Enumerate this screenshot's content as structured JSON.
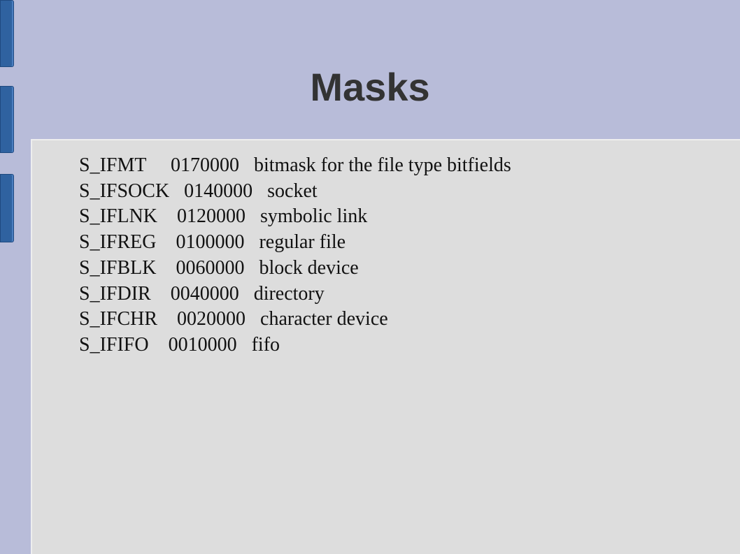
{
  "slide": {
    "title": "Masks",
    "lines": [
      "S_IFMT     0170000   bitmask for the file type bitfields",
      "S_IFSOCK   0140000   socket",
      "S_IFLNK    0120000   symbolic link",
      "S_IFREG    0100000   regular file",
      "S_IFBLK    0060000   block device",
      "S_IFDIR    0040000   directory",
      "S_IFCHR    0020000   character device",
      "S_IFIFO    0010000   fifo"
    ]
  },
  "colors": {
    "background": "#b8bcd9",
    "content_box": "#dddddd",
    "side_bars": "#2f62a0",
    "title": "#333333"
  }
}
